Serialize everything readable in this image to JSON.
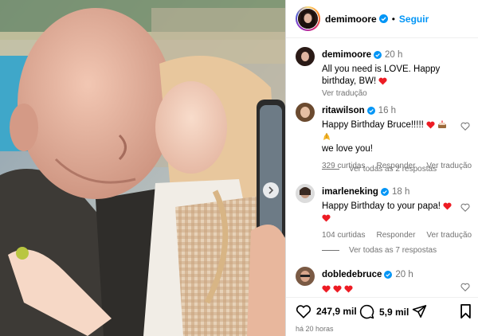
{
  "post": {
    "username": "demimoore",
    "follow_label": "Seguir",
    "separator": "•",
    "caption_time": "20 h",
    "caption_text": "All you need is LOVE. Happy birthday, BW!",
    "translate_label": "Ver tradução"
  },
  "comments": [
    {
      "username": "ritawilson",
      "time": "16 h",
      "text_line1": "Happy Birthday Bruce!!!!!",
      "text_line2": "we love you!",
      "emojis": [
        "red-heart",
        "cake",
        "praying-hands"
      ],
      "likes": "329 curtidas",
      "reply_label": "Responder",
      "translate_label": "Ver tradução",
      "replies_label": "Ver todas as 2 respostas"
    },
    {
      "username": "imarleneking",
      "time": "18 h",
      "text_line1": "Happy Birthday to your papa!",
      "emojis": [
        "red-heart",
        "red-heart"
      ],
      "likes": "104 curtidas",
      "reply_label": "Responder",
      "translate_label": "Ver tradução",
      "replies_label": "Ver todas as 7 respostas"
    },
    {
      "username": "dobledebruce",
      "time": "20 h",
      "emojis": [
        "red-heart",
        "red-heart",
        "red-heart"
      ]
    }
  ],
  "actions": {
    "likes": "247,9 mil",
    "comments": "5,9 mil",
    "posted_ago": "há 20 horas"
  },
  "colors": {
    "accent": "#0095f6",
    "verified": "#0095f6",
    "secondary_text": "#737373",
    "heart": "#ed1c24"
  }
}
